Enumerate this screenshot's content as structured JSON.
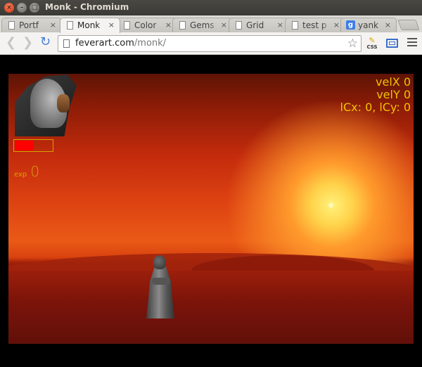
{
  "window": {
    "title": "Monk - Chromium",
    "close_glyph": "×",
    "min_glyph": "–",
    "max_glyph": "□"
  },
  "tabs": [
    {
      "label": "Portf",
      "icon": "page-icon",
      "active": false
    },
    {
      "label": "Monk",
      "icon": "page-icon",
      "active": true
    },
    {
      "label": "Color",
      "icon": "page-icon",
      "active": false
    },
    {
      "label": "Gems",
      "icon": "page-icon",
      "active": false
    },
    {
      "label": "Grid",
      "icon": "page-icon",
      "active": false
    },
    {
      "label": "test p",
      "icon": "page-icon",
      "active": false
    },
    {
      "label": "yank",
      "icon": "google-icon",
      "active": false
    }
  ],
  "tab_close_glyph": "×",
  "toolbar": {
    "back_glyph": "❮",
    "forward_glyph": "❯",
    "reload_glyph": "↻",
    "url_host": "feverart.com",
    "url_path": "/monk/",
    "star_glyph": "☆",
    "css_label": "CSS",
    "google_glyph": "g"
  },
  "hud": {
    "exp_label": "exp",
    "exp_value": "0",
    "health_fraction": 0.5,
    "stats": {
      "velX": "velX 0",
      "velY": "velY 0",
      "cell": "lCx: 0, lCy: 0"
    }
  },
  "colors": {
    "health": "#ff0000",
    "hud_text": "#f3c100",
    "exp_text": "#d9a400"
  }
}
